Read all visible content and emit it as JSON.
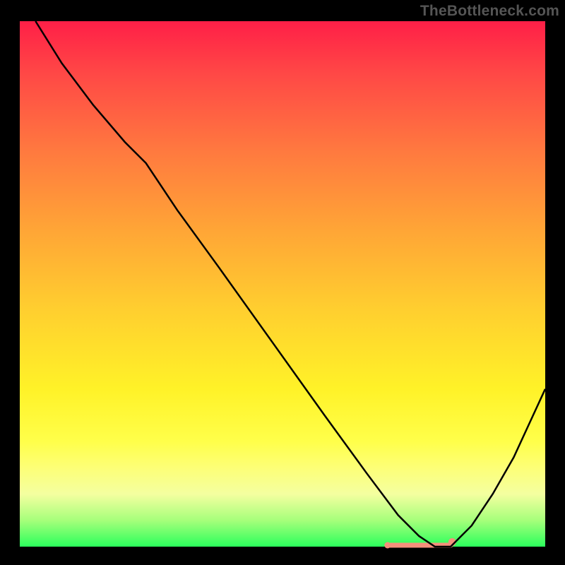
{
  "watermark": "TheBottleneck.com",
  "chart_data": {
    "type": "line",
    "title": "",
    "xlabel": "",
    "ylabel": "",
    "xlim": [
      0,
      100
    ],
    "ylim": [
      0,
      100
    ],
    "series": [
      {
        "name": "bottleneck-curve",
        "x": [
          3,
          8,
          14,
          20,
          24,
          30,
          38,
          48,
          58,
          66,
          72,
          76,
          79,
          82,
          86,
          90,
          94,
          100
        ],
        "y": [
          100,
          92,
          84,
          77,
          73,
          64,
          53,
          39,
          25,
          14,
          6,
          2,
          0,
          0,
          4,
          10,
          17,
          30
        ]
      }
    ],
    "markers": {
      "name": "highlight-band",
      "x_start": 70,
      "x_end": 82,
      "y": 0,
      "color": "#f58f7b",
      "end_dot_x": 82.3,
      "end_dot_y": 0.6
    }
  }
}
